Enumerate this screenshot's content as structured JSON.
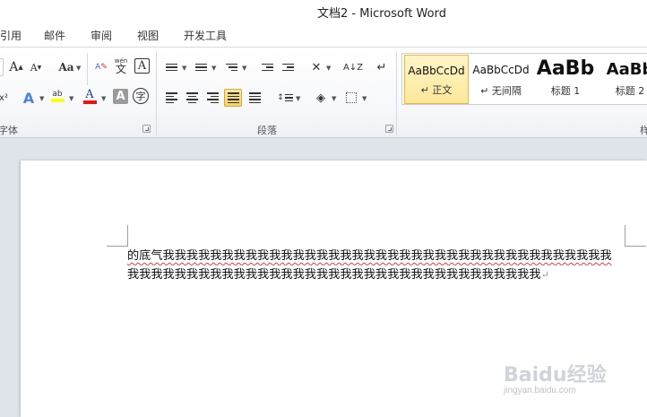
{
  "window": {
    "title": "文档2 - Microsoft Word"
  },
  "tabs": [
    "引用",
    "邮件",
    "审阅",
    "视图",
    "开发工具"
  ],
  "ribbon": {
    "font_group": {
      "label": "字体",
      "grow_glyph": "A",
      "shrink_glyph": "A",
      "change_case_glyph": "Aa",
      "wen_glyph": "wén",
      "border_char_glyph": "A",
      "superscript_glyph": "x²",
      "text_effects_glyph": "A",
      "highlight_glyph": "ab",
      "font_color_glyph": "A",
      "char_shading_glyph": "A",
      "enclose_glyph": "字",
      "highlight_color": "#ffff00",
      "font_color": "#e81416"
    },
    "paragraph_group": {
      "label": "段落",
      "sort_glyph": "A↓Z",
      "asian_layout_glyph": "✕",
      "show_marks_glyph": "↵"
    },
    "styles_group": {
      "label": "样",
      "items": [
        {
          "preview": "AaBbCcDd",
          "name": "↵ 正文"
        },
        {
          "preview": "AaBbCcDd",
          "name": "↵ 无间隔"
        },
        {
          "preview": "AaBb",
          "name": "标题 1"
        },
        {
          "preview": "AaBb",
          "name": "标题 2"
        }
      ]
    }
  },
  "document": {
    "line1": "的底气我我我我我我我我我我我我我我我我我我我我我我我我我我我我我我我我我我我我我我",
    "line2": "我我我我我我我我我我我我我我我我我我我我我我我我我我我我我我我我我我我",
    "para_mark": "↵"
  },
  "watermark": {
    "brand": "Baidu经验",
    "url": "jingyan.baidu.com"
  }
}
